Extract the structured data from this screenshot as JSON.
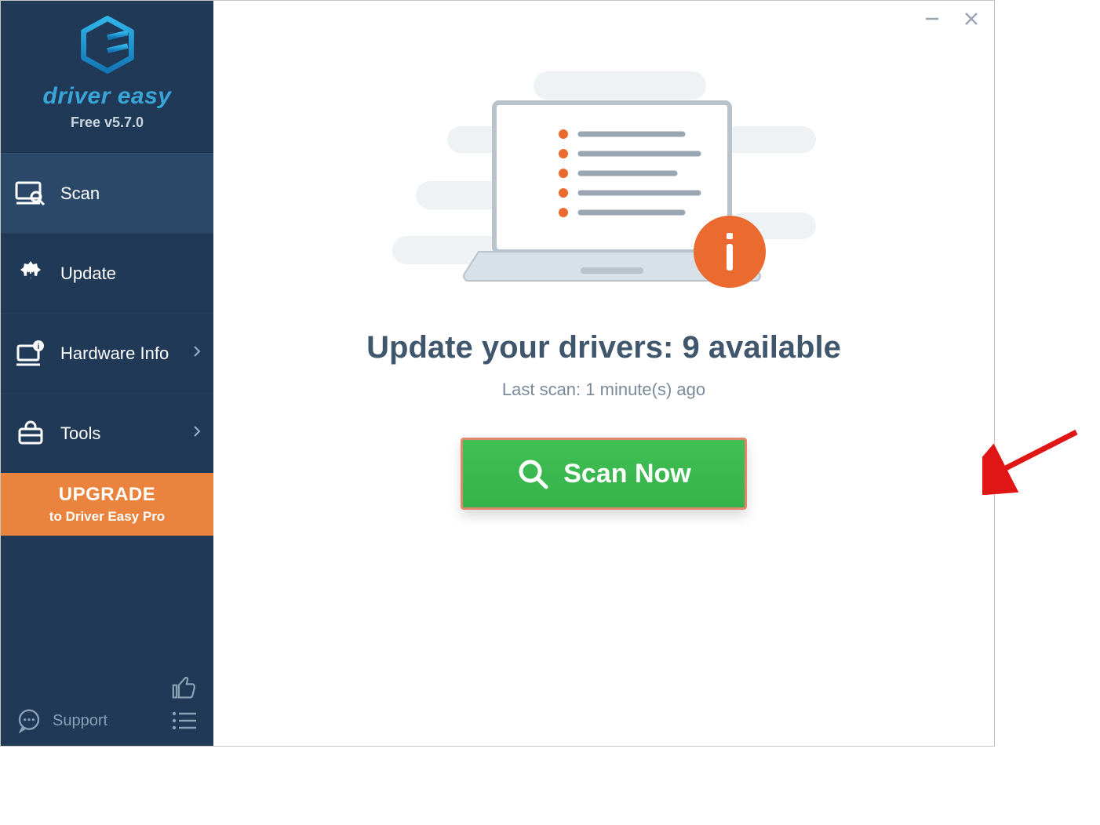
{
  "brand": {
    "name": "driver easy",
    "version": "Free v5.7.0"
  },
  "sidebar": {
    "items": [
      {
        "label": "Scan",
        "icon": "monitor-search-icon",
        "active": true,
        "chevron": false
      },
      {
        "label": "Update",
        "icon": "gear-icon",
        "active": false,
        "chevron": false
      },
      {
        "label": "Hardware Info",
        "icon": "hardware-info-icon",
        "active": false,
        "chevron": true
      },
      {
        "label": "Tools",
        "icon": "tools-icon",
        "active": false,
        "chevron": true
      }
    ],
    "upgrade": {
      "line1": "UPGRADE",
      "line2": "to Driver Easy Pro"
    },
    "support_label": "Support"
  },
  "main": {
    "headline": "Update your drivers: 9 available",
    "subline": "Last scan: 1 minute(s) ago",
    "scan_button": "Scan Now"
  }
}
